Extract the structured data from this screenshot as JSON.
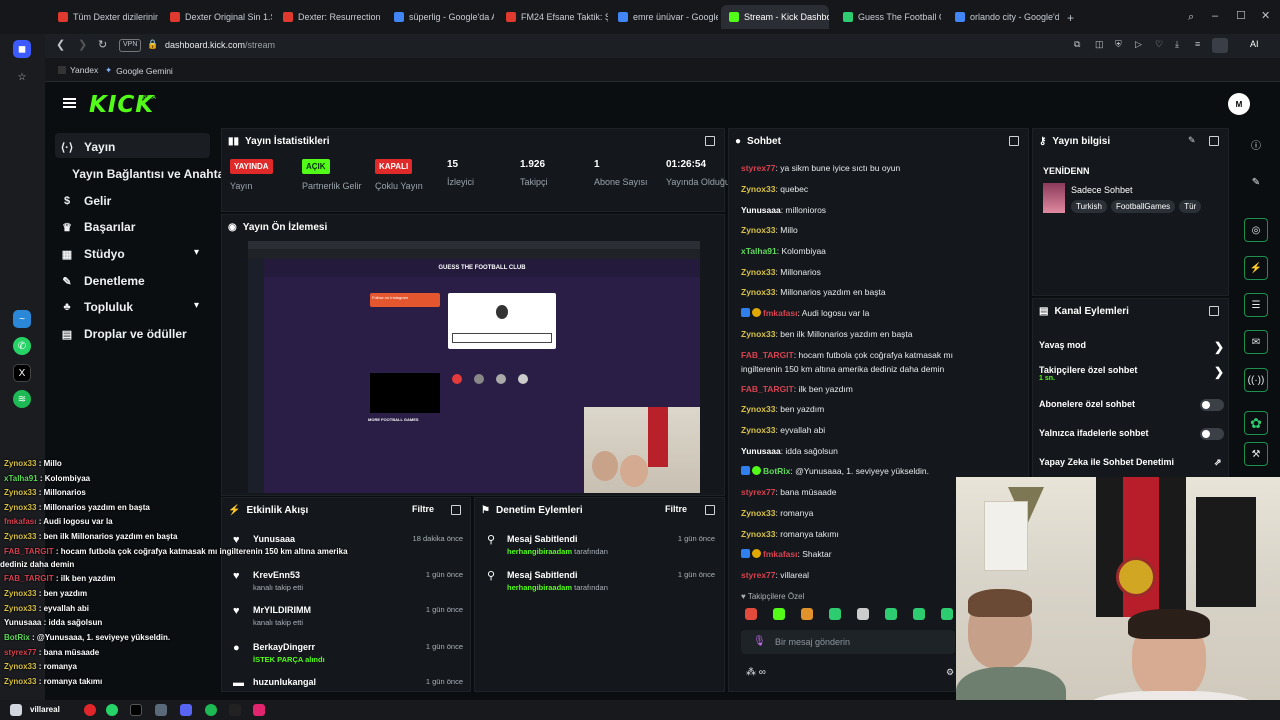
{
  "browser": {
    "tabs": [
      {
        "label": "Tüm Dexter dizilerinin kro",
        "color": "#e03a2f"
      },
      {
        "label": "Dexter Original Sin 1.Sez",
        "color": "#e03a2f"
      },
      {
        "label": "Dexter: Resurrection 1.Se",
        "color": "#e03a2f"
      },
      {
        "label": "süperlig - Google'da Ara",
        "color": "#4285f4"
      },
      {
        "label": "FM24 Efsane Taktik: Şamp",
        "color": "#e03a2f"
      },
      {
        "label": "emre ünüvar - Google'da",
        "color": "#4285f4"
      },
      {
        "label": "Stream - Kick Dashboard",
        "color": "#53fc18"
      },
      {
        "label": "Guess The Football Cl",
        "color": "#2ecc71"
      },
      {
        "label": "orlando city - Google'da A",
        "color": "#4285f4"
      }
    ],
    "url_domain": "dashboard.kick.com",
    "url_path": "/stream",
    "vpn": "VPN",
    "bookmarks": [
      "Yandex",
      "Google Gemini"
    ],
    "ai_label": "AI"
  },
  "kick": {
    "logo": "KICK",
    "beta": "BETA",
    "avatar_initial": "M",
    "nav": [
      {
        "label": "Yayın",
        "icon": "⟨·⟩"
      },
      {
        "label": "Yayın Bağlantısı ve Anahtarı",
        "icon": ""
      },
      {
        "label": "Gelir",
        "icon": "$"
      },
      {
        "label": "Başarılar",
        "icon": "♛"
      },
      {
        "label": "Stüdyo",
        "icon": "▦"
      },
      {
        "label": "Denetleme",
        "icon": "✎"
      },
      {
        "label": "Topluluk",
        "icon": "♣"
      },
      {
        "label": "Droplar ve ödüller",
        "icon": "▤"
      }
    ],
    "stats": {
      "title": "Yayın İstatistikleri",
      "items": [
        {
          "badge": "YAYINDA",
          "label": "Yayın"
        },
        {
          "badge": "AÇIK",
          "label": "Partnerlik Gelir"
        },
        {
          "badge": "KAPALI",
          "label": "Çoklu Yayın"
        },
        {
          "value": "15",
          "label": "İzleyici"
        },
        {
          "value": "1.926",
          "label": "Takipçi"
        },
        {
          "value": "1",
          "label": "Abone Sayısı"
        },
        {
          "value": "01:26:54",
          "label": "Yayında Olduğu"
        }
      ]
    },
    "preview": {
      "title": "Yayın Ön İzlemesi",
      "game_title": "GUESS THE FOOTBALL CLUB",
      "follow_label": "Follow on Instagram",
      "subtitle": "MORE FOOTBALL GAMES"
    },
    "activity": {
      "title": "Etkinlik Akışı",
      "filter": "Filtre",
      "items": [
        {
          "name": "Yunusaaa",
          "sub": "",
          "time": "18 dakika önce",
          "icon": "♥"
        },
        {
          "name": "KrevEnn53",
          "sub": "kanalı takip etti",
          "time": "1 gün önce",
          "icon": "♥"
        },
        {
          "name": "MrYILDIRIMM",
          "sub": "kanalı takip etti",
          "time": "1 gün önce",
          "icon": "♥"
        },
        {
          "name": "BerkayDingerr",
          "sub": "İSTEK PARÇA alındı",
          "time": "1 gün önce",
          "icon": "●"
        },
        {
          "name": "huzunlukangal",
          "sub": "",
          "time": "1 gün önce",
          "icon": "▬"
        }
      ]
    },
    "moderation": {
      "title": "Denetim Eylemleri",
      "filter": "Filtre",
      "items": [
        {
          "action": "Mesaj Sabitlendi",
          "user": "herhangibiraadam",
          "suffix": "tarafından",
          "time": "1 gün önce"
        },
        {
          "action": "Mesaj Sabitlendi",
          "user": "herhangibiraadam",
          "suffix": "tarafından",
          "time": "1 gün önce"
        }
      ]
    },
    "chat": {
      "title": "Sohbet",
      "messages": [
        {
          "user": "styrex77",
          "cls": "ur",
          "text": "ya sikm bune iyice sıctı bu oyun"
        },
        {
          "user": "Zynox33",
          "cls": "ux",
          "text": "quebec"
        },
        {
          "user": "Yunusaaa",
          "cls": "uw",
          "text": "millonioros"
        },
        {
          "user": "Zynox33",
          "cls": "ux",
          "text": "Millo"
        },
        {
          "user": "xTalha91",
          "cls": "ut",
          "text": "Kolombiyaa"
        },
        {
          "user": "Zynox33",
          "cls": "ux",
          "text": "Millonarios"
        },
        {
          "user": "Zynox33",
          "cls": "ux",
          "text": "Millonarios yazdım en başta"
        },
        {
          "user": "fmkafası",
          "cls": "ur",
          "text": "Audi logosu var la"
        },
        {
          "user": "Zynox33",
          "cls": "ux",
          "text": "ben ilk Millonarios yazdım en başta"
        },
        {
          "user": "FAB_TARGIT",
          "cls": "ur",
          "text": "hocam futbola çok coğrafya katmasak mı"
        },
        {
          "user": "",
          "cls": "uw",
          "text": "ingilterenin 150 km altına amerika dediniz daha demin"
        },
        {
          "user": "FAB_TARGIT",
          "cls": "ur",
          "text": "ilk ben yazdım"
        },
        {
          "user": "Zynox33",
          "cls": "ux",
          "text": "ben yazdım"
        },
        {
          "user": "Zynox33",
          "cls": "ux",
          "text": "eyvallah abi"
        },
        {
          "user": "Yunusaaa",
          "cls": "uw",
          "text": "idda sağolsun"
        },
        {
          "user": "BotRix",
          "cls": "ut",
          "text": "@Yunusaaa, 1. seviyeye yükseldin."
        },
        {
          "user": "styrex77",
          "cls": "ur",
          "text": "bana müsaade"
        },
        {
          "user": "Zynox33",
          "cls": "ux",
          "text": "romanya"
        },
        {
          "user": "Zynox33",
          "cls": "ux",
          "text": "romanya takımı"
        },
        {
          "user": "fmkafası",
          "cls": "ur",
          "text": "Shaktar"
        },
        {
          "user": "styrex77",
          "cls": "ur",
          "text": "villareal"
        }
      ],
      "followers_only": "Takipçilere Özel",
      "placeholder": "Bir mesaj gönderin"
    },
    "info": {
      "title": "Yayın bilgisi",
      "stream_title": "YENİDENN",
      "category": "Sadece Sohbet",
      "tags": [
        "Turkish",
        "FootballGames",
        "Tür"
      ]
    },
    "channel_actions": {
      "title": "Kanal Eylemleri",
      "items": [
        {
          "label": "Yavaş mod",
          "type": "arrow",
          "sub": ""
        },
        {
          "label": "Takipçilere özel sohbet",
          "type": "arrow",
          "sub": "1 sn."
        },
        {
          "label": "Abonelere özel sohbet",
          "type": "toggle",
          "sub": ""
        },
        {
          "label": "Yalnızca ifadelerle sohbet",
          "type": "toggle",
          "sub": ""
        },
        {
          "label": "Yapay Zeka ile Sohbet Denetimi",
          "type": "link",
          "sub": ""
        }
      ]
    }
  },
  "overlay_chat": [
    {
      "u": "Zynox33",
      "t": "Millo",
      "c": "#d8c144"
    },
    {
      "u": "xTalha91",
      "t": "Kolombiyaa",
      "c": "#60d95a"
    },
    {
      "u": "Zynox33",
      "t": "Millonarios",
      "c": "#d8c144"
    },
    {
      "u": "Zynox33",
      "t": "Millonarios yazdım en başta",
      "c": "#d8c144"
    },
    {
      "u": "fmkafası",
      "t": "Audi logosu var la",
      "c": "#d64251"
    },
    {
      "u": "Zynox33",
      "t": "ben ilk Millonarios yazdım en başta",
      "c": "#d8c144"
    },
    {
      "u": "FAB_TARGIT",
      "t": "hocam futbola çok coğrafya katmasak mı ingilterenin 150 km altına amerika",
      "c": "#d64251"
    },
    {
      "u": "",
      "t": "dediniz daha demin",
      "c": "#fff"
    },
    {
      "u": "FAB_TARGIT",
      "t": "ilk ben yazdım",
      "c": "#d64251"
    },
    {
      "u": "Zynox33",
      "t": "ben yazdım",
      "c": "#d8c144"
    },
    {
      "u": "Zynox33",
      "t": "eyvallah abi",
      "c": "#d8c144"
    },
    {
      "u": "Yunusaaa",
      "t": "idda sağolsun",
      "c": "#fff"
    },
    {
      "u": "BotRix",
      "t": "@Yunusaaa, 1. seviyeye yükseldin.",
      "c": "#60d95a"
    },
    {
      "u": "styrex77",
      "t": "bana müsaade",
      "c": "#d64251"
    },
    {
      "u": "Zynox33",
      "t": "romanya",
      "c": "#d8c144"
    },
    {
      "u": "Zynox33",
      "t": "romanya takımı",
      "c": "#d8c144"
    },
    {
      "u": "fmkafası",
      "t": "Shaktar",
      "c": "#d64251"
    },
    {
      "u": "styrex77",
      "t": "villareal",
      "c": "#d64251"
    }
  ]
}
